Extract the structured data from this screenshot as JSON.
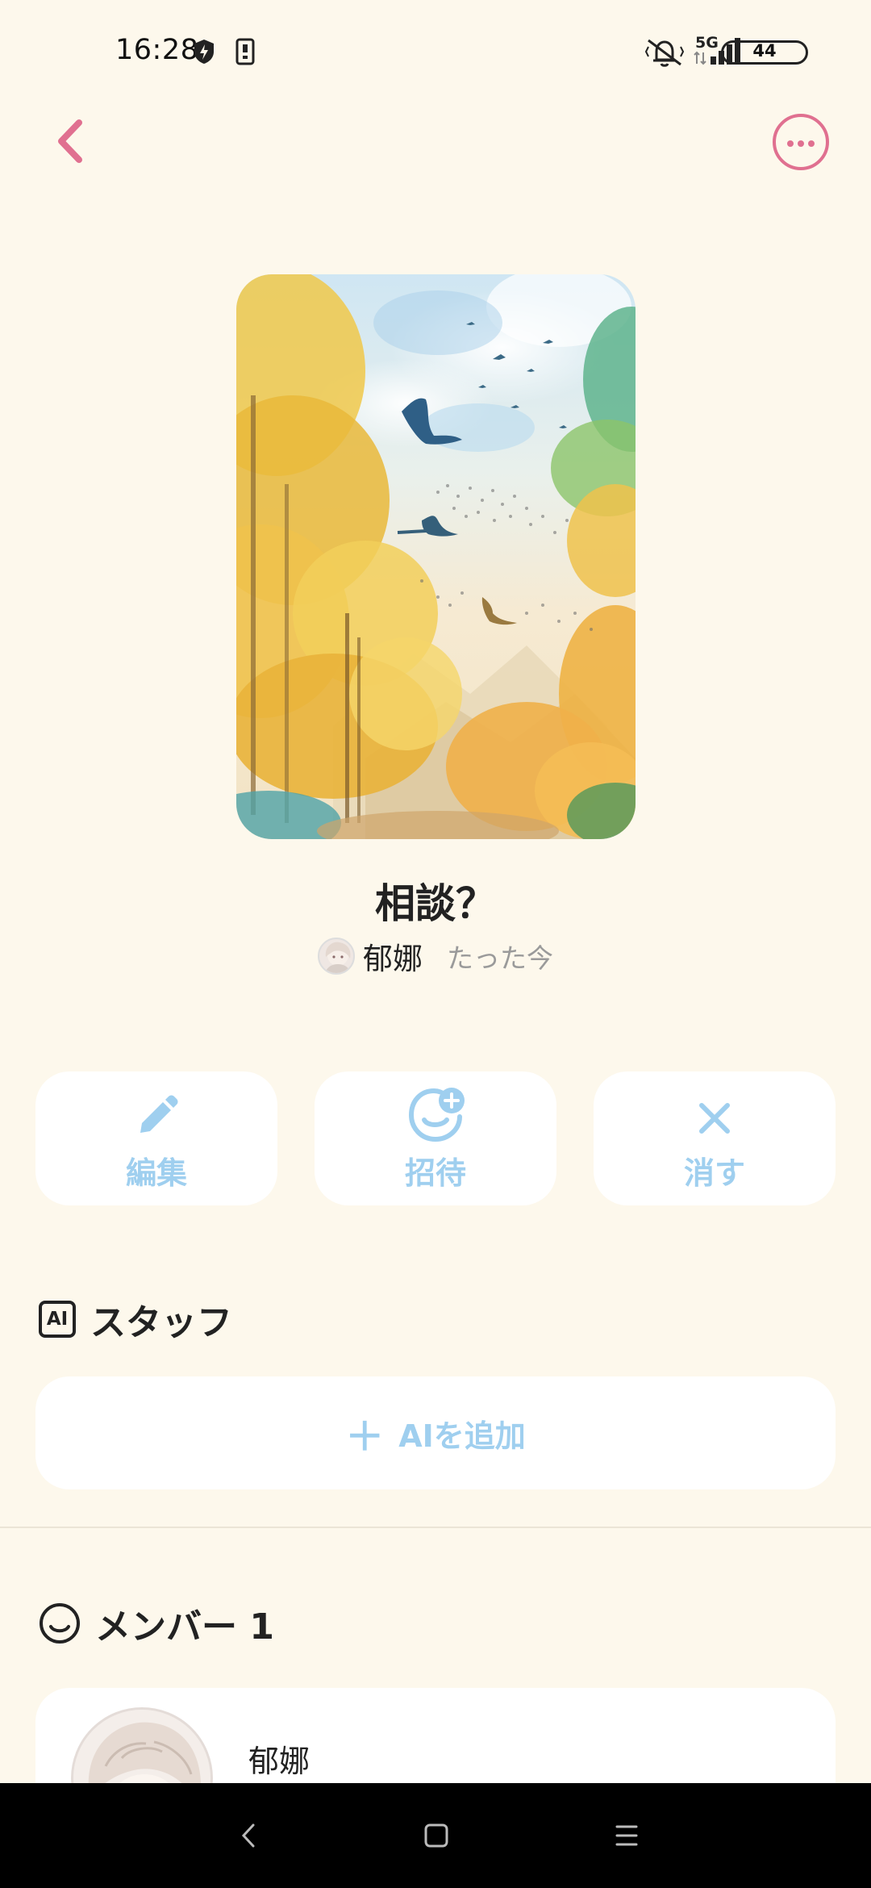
{
  "status_bar": {
    "time": "16:28",
    "network": "5G",
    "battery": "44"
  },
  "header": {
    "back_icon": "chevron-left-icon",
    "more_icon": "more-horizontal-icon",
    "accent_color": "#e07090"
  },
  "post": {
    "title": "相談？",
    "author": "郁娜",
    "time": "たった今"
  },
  "actions": [
    {
      "label": "編集",
      "icon": "pencil-icon"
    },
    {
      "label": "招待",
      "icon": "invite-smile-icon"
    },
    {
      "label": "消す",
      "icon": "close-icon"
    }
  ],
  "ai_section": {
    "badge": "AI",
    "title": "スタッフ",
    "add_label": "AIを追加"
  },
  "member_section": {
    "title": "メンバー 1",
    "members": [
      {
        "name": "郁娜"
      }
    ]
  },
  "colors": {
    "background": "#fdf8ec",
    "action_text": "#9fcfef",
    "card": "#ffffff"
  }
}
